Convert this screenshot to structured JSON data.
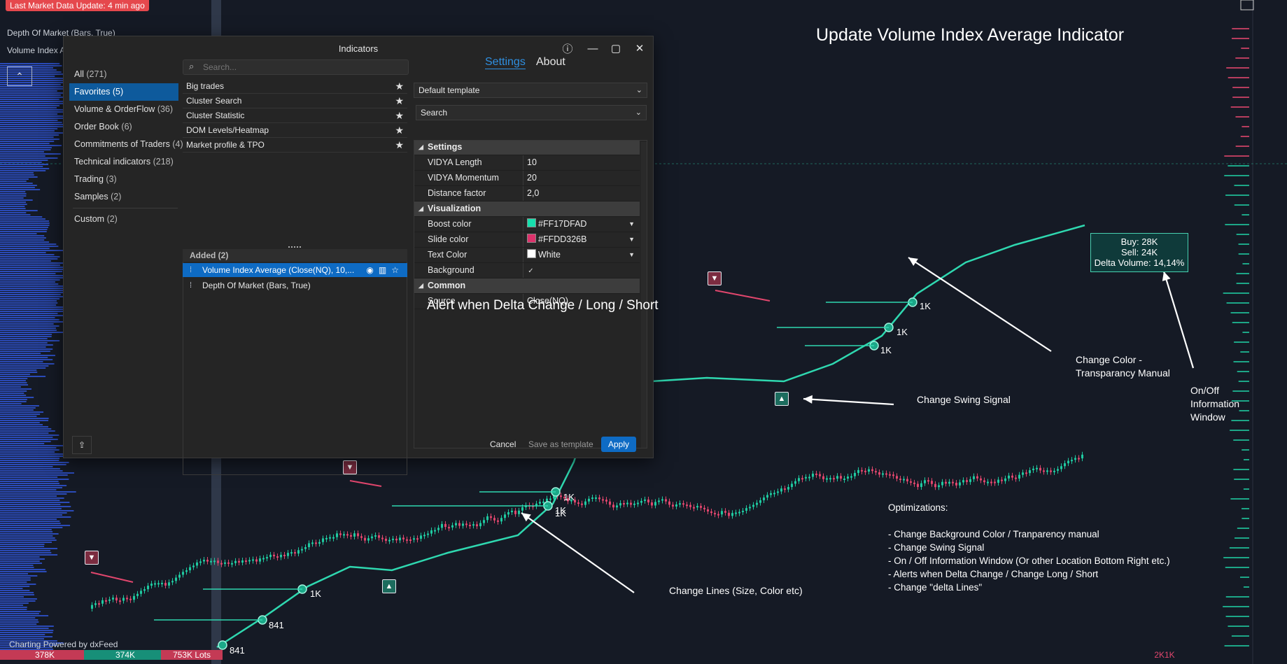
{
  "chart": {
    "status_badge": "Last Market Data Update: 4 min ago",
    "legend_dom": "Depth Of Market (Bars, True)",
    "legend_via": "Volume Index A",
    "footer_credit": "Charting Powered by dxFeed",
    "vol_chips": [
      "378K",
      "374K",
      "753K Lots"
    ],
    "right_chip": "2K1K",
    "pin_labels": [
      "1K",
      "1K",
      "1K",
      "1K",
      "1K",
      "841",
      "841"
    ],
    "pin_label_stack": "1K"
  },
  "overlay": {
    "title": "Update Volume Index Average Indicator",
    "alert_text": "Alert when Delta Change / Long / Short",
    "change_color": "Change Color -\nTransparancy Manual",
    "on_off": "On/Off\nInformation\nWindow",
    "change_swing": "Change Swing Signal",
    "change_lines": "Change Lines (Size, Color etc)",
    "optimizations_title": "Optimizations:",
    "optimizations": [
      "- Change Background Color / Tranparency manual",
      "- Change Swing Signal",
      "- On / Off Information Window (Or other Location Bottom Right etc.)",
      "- Alerts when Delta Change / Change Long / Short",
      "- Change \"delta Lines\""
    ]
  },
  "info_window": {
    "buy": "Buy: 28K",
    "sell": "Sell: 24K",
    "delta": "Delta Volume: 14,14%"
  },
  "dialog": {
    "title": "Indicators",
    "categories": [
      {
        "label": "All",
        "count": "(271)"
      },
      {
        "label": "Favorites",
        "count": "(5)"
      },
      {
        "label": "Volume & OrderFlow",
        "count": "(36)"
      },
      {
        "label": "Order Book",
        "count": "(6)"
      },
      {
        "label": "Commitments of Traders",
        "count": "(4)"
      },
      {
        "label": "Technical indicators",
        "count": "(218)"
      },
      {
        "label": "Trading",
        "count": "(3)"
      },
      {
        "label": "Samples",
        "count": "(2)"
      },
      {
        "label": "Custom",
        "count": "(2)"
      }
    ],
    "search_placeholder": "Search...",
    "favorites": [
      "Big trades",
      "Cluster Search",
      "Cluster Statistic",
      "DOM Levels/Heatmap",
      "Market profile & TPO"
    ],
    "added_header": "Added (2)",
    "added": [
      "Volume Index Average (Close(NQ), 10,...",
      "Depth Of Market (Bars, True)"
    ],
    "tabs": {
      "settings": "Settings",
      "about": "About"
    },
    "template_select": "Default template",
    "filter_select": "Search",
    "groups": {
      "settings": "Settings",
      "visualization": "Visualization",
      "common": "Common"
    },
    "props": {
      "vidya_length": {
        "k": "VIDYA Length",
        "v": "10"
      },
      "vidya_momentum": {
        "k": "VIDYA Momentum",
        "v": "20"
      },
      "distance_factor": {
        "k": "Distance factor",
        "v": "2,0"
      },
      "boost_color": {
        "k": "Boost color",
        "v": "#FF17DFAD",
        "swatch": "#17dfad"
      },
      "slide_color": {
        "k": "Slide color",
        "v": "#FFDD326B",
        "swatch": "#dd326b"
      },
      "text_color": {
        "k": "Text Color",
        "v": "White",
        "swatch": "#ffffff"
      },
      "background": {
        "k": "Background",
        "checked": true
      },
      "source": {
        "k": "Source",
        "v": "Close(NQ)"
      }
    },
    "buttons": {
      "cancel": "Cancel",
      "save_template": "Save as template",
      "apply": "Apply"
    }
  },
  "colors": {
    "bull": "#1fc9a0",
    "bear": "#e0466d",
    "vidya": "#2fd8b0",
    "accent": "#0e6bc4",
    "profile": "#2f55d4"
  }
}
